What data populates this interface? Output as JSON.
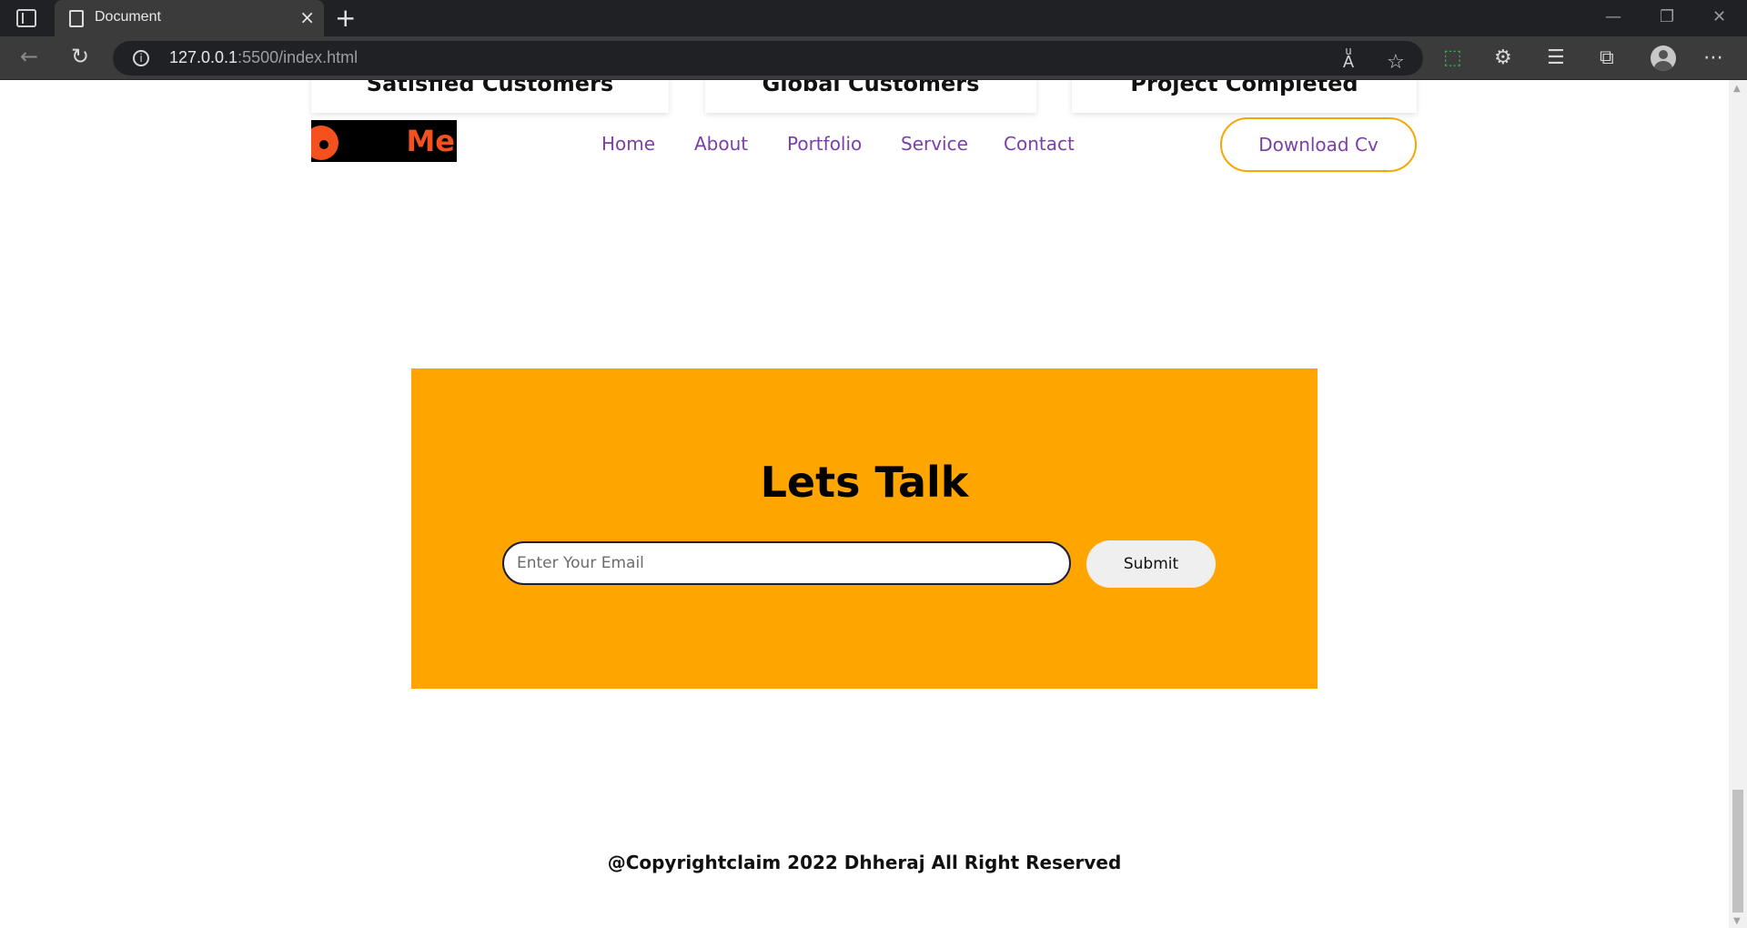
{
  "browser": {
    "tab_title": "Document",
    "url_host": "127.0.0.1",
    "url_path": ":5500/index.html",
    "new_tab_symbol": "+",
    "tab_close_symbol": "×"
  },
  "stats": [
    {
      "label": "Satisfied Customers"
    },
    {
      "label": "Global Customers"
    },
    {
      "label": "Project Completed"
    }
  ],
  "logo": {
    "text": "Me",
    "colors": {
      "background": "#000000",
      "accent": "#f4511e"
    }
  },
  "nav": {
    "links": [
      "Home",
      "About",
      "Portfolio",
      "Service",
      "Contact"
    ],
    "cv_button": "Download Cv",
    "link_color": "#7a3fa8",
    "button_border_color": "#f5a800"
  },
  "contact": {
    "title": "Lets Talk",
    "email_placeholder": "Enter Your Email",
    "submit_label": "Submit",
    "background_color": "#ffa500"
  },
  "footer": {
    "text": "@Copyrightclaim 2022 Dhheraj All Right Reserved"
  }
}
